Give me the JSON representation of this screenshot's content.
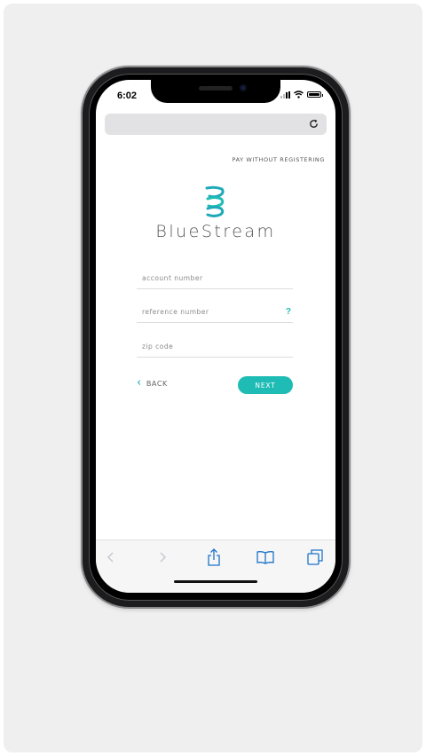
{
  "status_bar": {
    "time": "6:02"
  },
  "header": {
    "pay_without_registering": "PAY WITHOUT REGISTERING"
  },
  "brand": {
    "name": "BlueStream",
    "accent_color": "#1fbcb5"
  },
  "form": {
    "account_number": {
      "placeholder": "account number",
      "value": ""
    },
    "reference_number": {
      "placeholder": "reference number",
      "value": "",
      "help": "?"
    },
    "zip_code": {
      "placeholder": "zip code",
      "value": ""
    }
  },
  "actions": {
    "back_label": "BACK",
    "next_label": "NEXT"
  },
  "browser_toolbar": {
    "icons": [
      "back-arrow-icon",
      "forward-arrow-icon",
      "share-icon",
      "bookmarks-icon",
      "tabs-icon"
    ]
  }
}
